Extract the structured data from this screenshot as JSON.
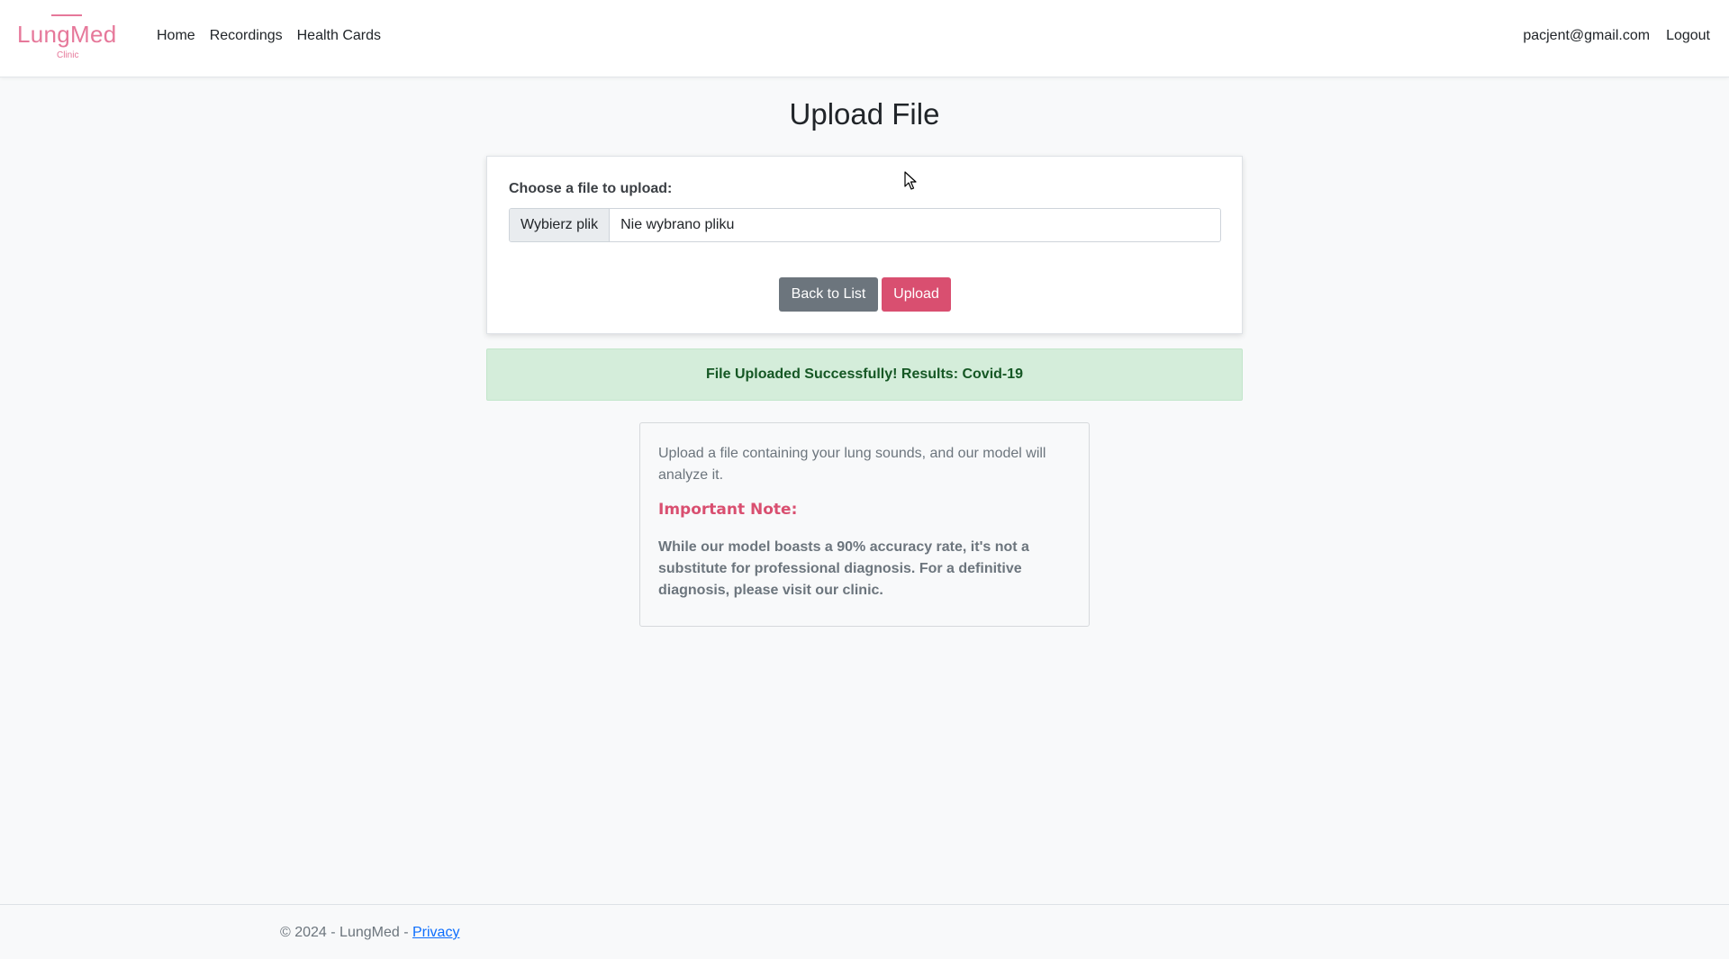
{
  "navbar": {
    "brand": {
      "name": "LungMed",
      "subtitle": "Clinic"
    },
    "links": [
      {
        "label": "Home"
      },
      {
        "label": "Recordings"
      },
      {
        "label": "Health Cards"
      }
    ],
    "user_email": "pacjent@gmail.com",
    "logout_label": "Logout"
  },
  "page": {
    "title": "Upload File"
  },
  "upload_form": {
    "label": "Choose a file to upload:",
    "file_button_label": "Wybierz plik",
    "file_status": "Nie wybrano pliku",
    "back_button_label": "Back to List",
    "upload_button_label": "Upload"
  },
  "alert": {
    "message": "File Uploaded Successfully! Results: Covid-19"
  },
  "info": {
    "description": "Upload a file containing your lung sounds, and our model will analyze it.",
    "note_title": "Important Note:",
    "note_text": "While our model boasts a 90% accuracy rate, it's not a substitute for professional diagnosis. For a definitive diagnosis, please visit our clinic."
  },
  "footer": {
    "copyright": "© 2024 - LungMed - ",
    "privacy_label": "Privacy"
  },
  "colors": {
    "brand": "#e6789a",
    "upload_button": "#d94f70",
    "back_button": "#6c757d",
    "alert_background": "#d4edda",
    "alert_text": "#155724"
  }
}
